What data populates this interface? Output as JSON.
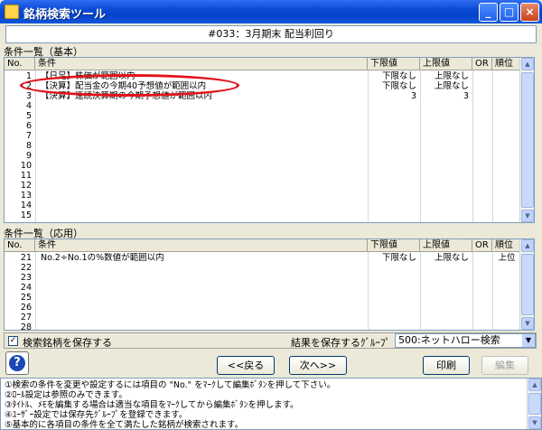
{
  "window": {
    "title": "銘柄検索ツール",
    "min_label": "_",
    "max_label": "□",
    "close_label": "×"
  },
  "subject": "#033：3月期末 配当利回り",
  "basic": {
    "section_label": "条件一覧（基本）",
    "headers": {
      "no": "No.",
      "condition": "条件",
      "lower": "下限値",
      "upper": "上限値",
      "or": "OR",
      "rank": "順位"
    },
    "rows": [
      {
        "no": "1",
        "condition": "【日足】株価が範囲以内",
        "lower": "下限なし",
        "upper": "上限なし",
        "or": "",
        "rank": ""
      },
      {
        "no": "2",
        "condition": "【決算】配当金の今期40予想値が範囲以内",
        "lower": "下限なし",
        "upper": "上限なし",
        "or": "",
        "rank": ""
      },
      {
        "no": "3",
        "condition": "【決算】連続決算期の今期予想値が範囲以内",
        "lower": "3",
        "upper": "3",
        "or": "",
        "rank": ""
      },
      {
        "no": "4",
        "condition": "",
        "lower": "",
        "upper": "",
        "or": "",
        "rank": ""
      },
      {
        "no": "5",
        "condition": "",
        "lower": "",
        "upper": "",
        "or": "",
        "rank": ""
      },
      {
        "no": "6",
        "condition": "",
        "lower": "",
        "upper": "",
        "or": "",
        "rank": ""
      },
      {
        "no": "7",
        "condition": "",
        "lower": "",
        "upper": "",
        "or": "",
        "rank": ""
      },
      {
        "no": "8",
        "condition": "",
        "lower": "",
        "upper": "",
        "or": "",
        "rank": ""
      },
      {
        "no": "9",
        "condition": "",
        "lower": "",
        "upper": "",
        "or": "",
        "rank": ""
      },
      {
        "no": "10",
        "condition": "",
        "lower": "",
        "upper": "",
        "or": "",
        "rank": ""
      },
      {
        "no": "11",
        "condition": "",
        "lower": "",
        "upper": "",
        "or": "",
        "rank": ""
      },
      {
        "no": "12",
        "condition": "",
        "lower": "",
        "upper": "",
        "or": "",
        "rank": ""
      },
      {
        "no": "13",
        "condition": "",
        "lower": "",
        "upper": "",
        "or": "",
        "rank": ""
      },
      {
        "no": "14",
        "condition": "",
        "lower": "",
        "upper": "",
        "or": "",
        "rank": ""
      },
      {
        "no": "15",
        "condition": "",
        "lower": "",
        "upper": "",
        "or": "",
        "rank": ""
      }
    ]
  },
  "applied": {
    "section_label": "条件一覧（応用）",
    "headers": {
      "no": "No.",
      "condition": "条件",
      "lower": "下限値",
      "upper": "上限値",
      "or": "OR",
      "rank": "順位"
    },
    "rows": [
      {
        "no": "21",
        "condition": "No.2÷No.1の%数値が範囲以内",
        "lower": "下限なし",
        "upper": "上限なし",
        "or": "",
        "rank": "上位"
      },
      {
        "no": "22",
        "condition": "",
        "lower": "",
        "upper": "",
        "or": "",
        "rank": ""
      },
      {
        "no": "23",
        "condition": "",
        "lower": "",
        "upper": "",
        "or": "",
        "rank": ""
      },
      {
        "no": "24",
        "condition": "",
        "lower": "",
        "upper": "",
        "or": "",
        "rank": ""
      },
      {
        "no": "25",
        "condition": "",
        "lower": "",
        "upper": "",
        "or": "",
        "rank": ""
      },
      {
        "no": "26",
        "condition": "",
        "lower": "",
        "upper": "",
        "or": "",
        "rank": ""
      },
      {
        "no": "27",
        "condition": "",
        "lower": "",
        "upper": "",
        "or": "",
        "rank": ""
      },
      {
        "no": "28",
        "condition": "",
        "lower": "",
        "upper": "",
        "or": "",
        "rank": ""
      }
    ]
  },
  "status": {
    "save_checkbox_checked": true,
    "save_checkbox_mark": "✓",
    "save_label": "検索銘柄を保存する",
    "group_label": "結果を保存するｸﾞﾙｰﾌﾟ",
    "group_value": "500:ネットハロー検索"
  },
  "buttons": {
    "help": "?",
    "prev": "<<戻る",
    "next": "次へ>>",
    "print": "印刷",
    "edit": "編集"
  },
  "info": [
    "①検索の条件を変更や設定するには項目の \"No.\" をﾏｰｸして編集ﾎﾞﾀﾝを押して下さい。",
    "②ﾛｰﾙ設定は参照のみできます。",
    "③ﾀｲﾄﾙ、ﾒﾓを編集する場合は適当な項目をﾏｰｸしてから編集ﾎﾞﾀﾝを押します。",
    "④ﾕｰｻﾞｰ設定では保存先ｸﾞﾙｰﾌﾟを登録できます。",
    "⑤基本的に各項目の条件を全て満たした銘柄が検索されます。"
  ]
}
